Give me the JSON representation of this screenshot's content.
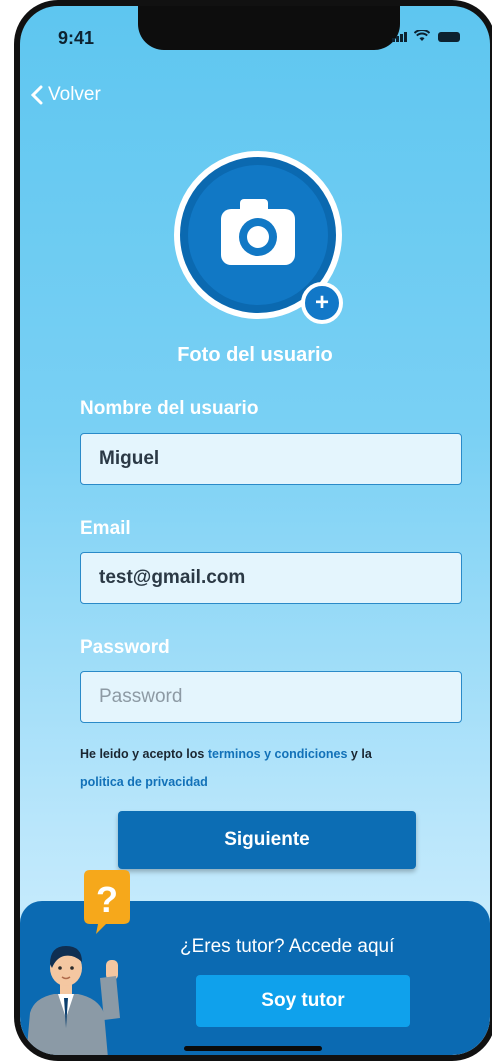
{
  "status_bar": {
    "time": "9:41"
  },
  "nav": {
    "back_label": "Volver"
  },
  "photo": {
    "label": "Foto del usuario",
    "badge": "+"
  },
  "form": {
    "name": {
      "label": "Nombre del usuario",
      "value": "Miguel"
    },
    "email": {
      "label": "Email",
      "value": "test@gmail.com"
    },
    "password": {
      "label": "Password",
      "placeholder": "Password"
    }
  },
  "terms": {
    "prefix": "He leido y acepto los ",
    "terms_link": "terminos y condiciones",
    "middle": " y la",
    "privacy_link": "politica de privacidad"
  },
  "buttons": {
    "next": "Siguiente",
    "tutor": "Soy tutor"
  },
  "tutor": {
    "question": "¿Eres tutor? Accede aquí",
    "bubble": "?"
  },
  "colors": {
    "primary": "#0c6db4",
    "accent": "#0fa1ec",
    "sky": "#5ec6f0"
  }
}
